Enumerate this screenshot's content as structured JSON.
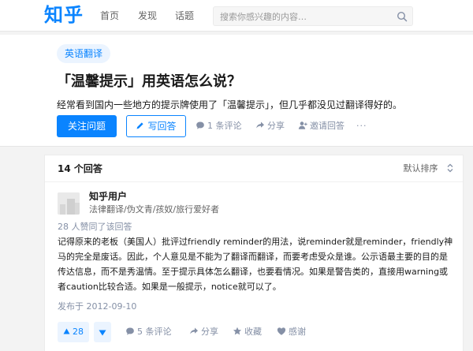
{
  "header": {
    "logo": "知乎",
    "nav": [
      "首页",
      "发现",
      "话题"
    ],
    "search_placeholder": "搜索你感兴趣的内容…"
  },
  "question": {
    "topic": "英语翻译",
    "title": "「温馨提示」用英语怎么说？",
    "detail": "经常看到国内一些地方的提示牌使用了「温馨提示」，但几乎都没见过翻译得好的。",
    "follow_label": "关注问题",
    "write_label": "写回答",
    "comments": "1 条评论",
    "share": "分享",
    "invite": "邀请回答",
    "more": "···"
  },
  "answers": {
    "count_label": "14  个回答",
    "sort_label": "默认排序",
    "items": [
      {
        "author": "知乎用户",
        "bio": "法律翻译/伪文青/孩奴/旅行爱好者",
        "vote_summary": "28 人赞同了该回答",
        "paragraphs": [
          "记得原来的老板（美国人）批评过friendly reminder的用法，说reminder就是reminder，friendly神马的完全是废话。因此，个人意见是不能为了翻译而翻译，而要考虑受众是谁。公示语最主要的目的是传达信息，而不是秀温情。至于提示具体怎么翻译，也要看情况。如果是警告类的，直接用warning或者caution比较合适。如果是一般提示，notice就可以了。"
        ],
        "date": "发布于 2012-09-10",
        "votes": "28",
        "comments": "5 条评论",
        "share": "分享",
        "collect": "收藏",
        "thanks": "感谢"
      }
    ]
  },
  "colors": {
    "brand": "#0a84ff",
    "brand_light": "#ebf4ff",
    "muted": "#8590a6"
  }
}
